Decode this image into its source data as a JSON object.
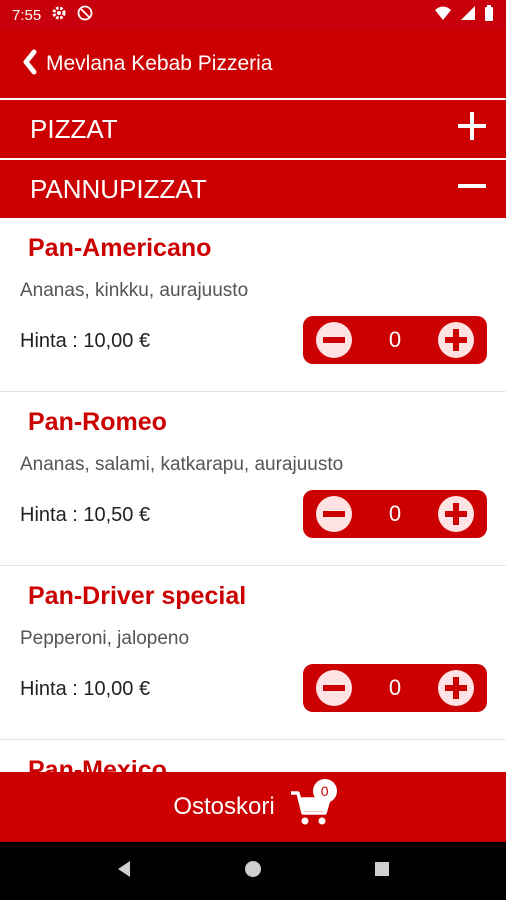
{
  "status": {
    "time": "7:55"
  },
  "appbar": {
    "title": "Mevlana Kebab Pizzeria"
  },
  "sections": [
    {
      "label": "PIZZAT",
      "toggle": "+"
    },
    {
      "label": "PANNUPIZZAT",
      "toggle": "−"
    }
  ],
  "items": [
    {
      "name": "Pan-Americano",
      "desc": "Ananas, kinkku, aurajuusto",
      "price": "Hinta : 10,00 €",
      "qty": "0"
    },
    {
      "name": "Pan-Romeo",
      "desc": "Ananas, salami, katkarapu, aurajuusto",
      "price": "Hinta : 10,50 €",
      "qty": "0"
    },
    {
      "name": "Pan-Driver special",
      "desc": "Pepperoni, jalopeno",
      "price": "Hinta : 10,00 €",
      "qty": "0"
    },
    {
      "name": "Pan-Mexico",
      "desc": "",
      "price": "",
      "qty": ""
    }
  ],
  "cart": {
    "label": "Ostoskori",
    "count": "0"
  },
  "colors": {
    "brand": "#cc0000",
    "text": "#222222",
    "muted": "#555555"
  }
}
